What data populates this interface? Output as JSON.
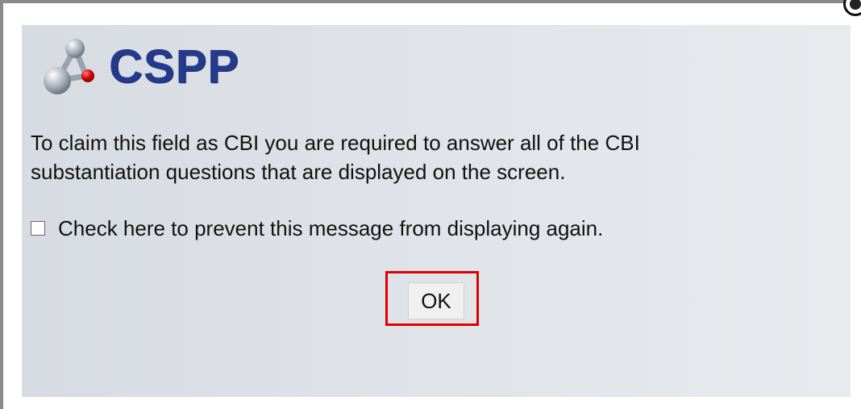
{
  "dialog": {
    "app_name": "CSPP",
    "message": "To claim this field as CBI you are required to answer all of the CBI substantiation questions that are displayed on the screen.",
    "checkbox_label": "Check here to prevent this message from displaying again.",
    "checkbox_checked": false,
    "ok_label": "OK"
  },
  "colors": {
    "brand": "#243a8c",
    "highlight": "#e00000",
    "panel": "#dfe2e8"
  },
  "icons": {
    "logo": "molecule-icon",
    "close": "close-icon"
  }
}
